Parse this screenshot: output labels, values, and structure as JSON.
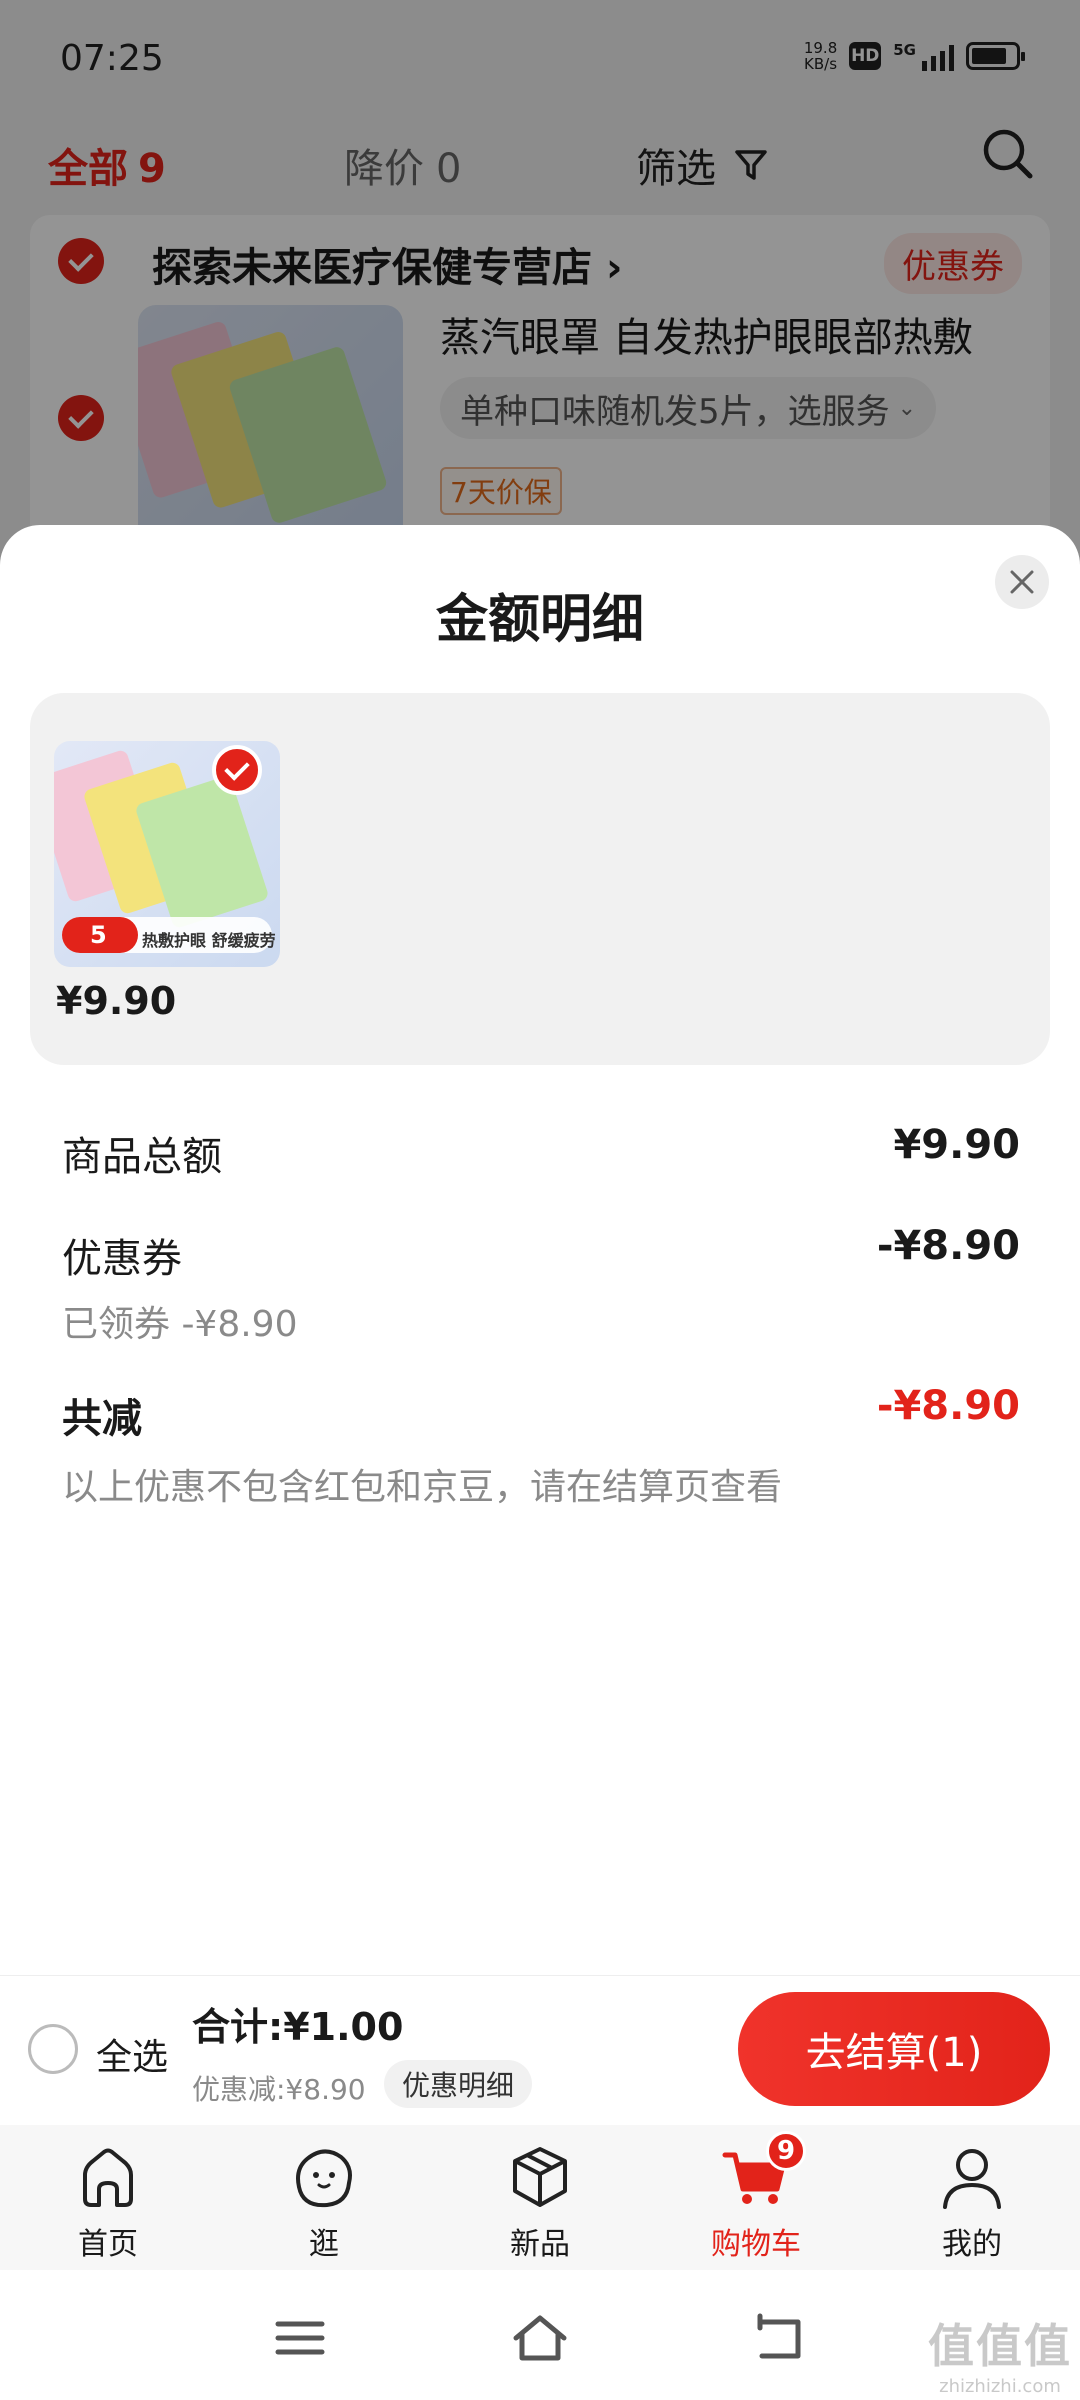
{
  "status_bar": {
    "time": "07:25",
    "net_speed_value": "19.8",
    "net_speed_unit": "KB/s",
    "hd_label": "HD",
    "network": "5G"
  },
  "filter_bar": {
    "all_label": "全部",
    "all_count": "9",
    "price_drop_label": "降价",
    "price_drop_count": "0",
    "filter_label": "筛选"
  },
  "store": {
    "name": "探索未来医疗保健专营店",
    "chevron": "›",
    "coupon_tag": "优惠券",
    "item": {
      "title": "蒸汽眼罩 自发热护眼眼部热敷",
      "sku": "单种口味随机发5片，选服务",
      "protect_tag": "7天价保"
    }
  },
  "sheet": {
    "title": "金额明细",
    "goods": [
      {
        "price": "¥9.90",
        "banner_count": "5",
        "banner_text": "热敷护眼 舒缓疲劳"
      }
    ],
    "rows": {
      "subtotal_label": "商品总额",
      "subtotal_value": "¥9.90",
      "coupon_label": "优惠券",
      "coupon_value": "-¥8.90",
      "coupon_sub": "已领券 -¥8.90",
      "total_discount_label": "共减",
      "total_discount_value": "-¥8.90",
      "note": "以上优惠不包含红包和京豆，请在结算页查看"
    }
  },
  "checkout": {
    "select_all": "全选",
    "total": "合计:¥1.00",
    "saved": "优惠减:¥8.90",
    "detail_chip": "优惠明细",
    "button": "去结算(1)"
  },
  "tabbar": {
    "items": [
      {
        "label": "首页",
        "icon": "home-icon"
      },
      {
        "label": "逛",
        "icon": "face-icon"
      },
      {
        "label": "新品",
        "icon": "box-icon"
      },
      {
        "label": "购物车",
        "icon": "cart-icon",
        "active": true,
        "badge": "9"
      },
      {
        "label": "我的",
        "icon": "person-icon"
      }
    ]
  },
  "watermark": {
    "big": "值值值",
    "small": "zhizhizhi.com"
  },
  "colors": {
    "accent": "#e2231a",
    "muted": "#8a8a8a"
  }
}
